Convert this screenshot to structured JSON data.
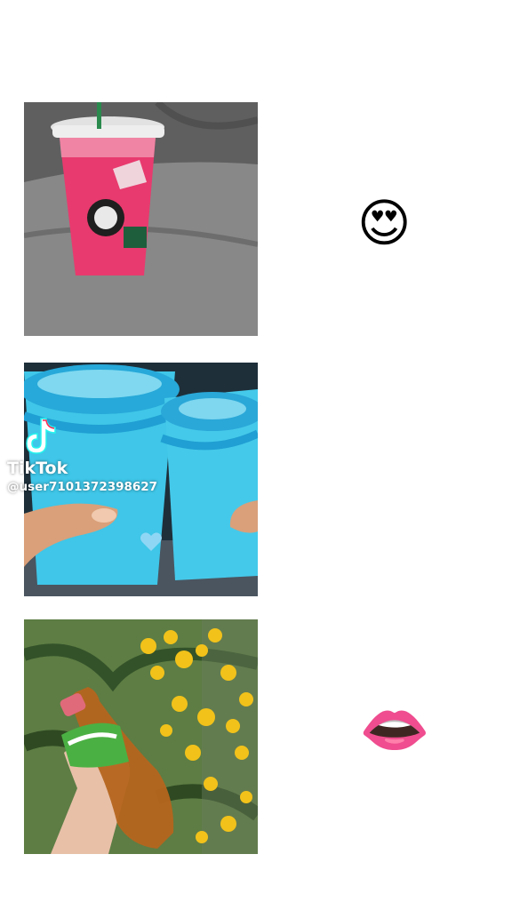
{
  "watermark": {
    "brand": "TikTok",
    "username": "@user7101372398627"
  },
  "emojis": {
    "first": "😍",
    "second": "👄"
  },
  "colors": {
    "background": "#ffffff",
    "refresher_pink": "#e83a6e",
    "blue_drink": "#3fc6e8",
    "sofa_gray": "#707070",
    "flower_yellow": "#f2c21a",
    "leaf_green": "#3f6a2c",
    "iced_tea": "#b5651d"
  }
}
